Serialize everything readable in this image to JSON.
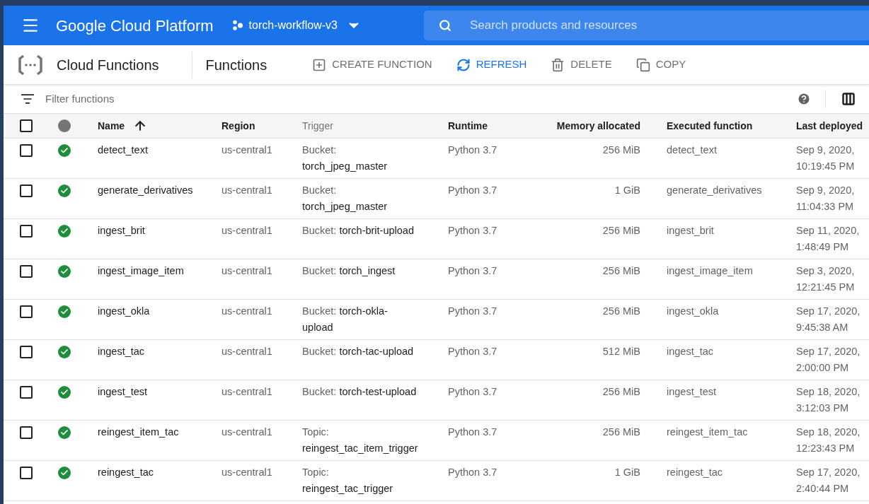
{
  "header": {
    "product": "Google Cloud Platform",
    "project": "torch-workflow-v3",
    "search": {
      "placeholder": "Search products and resources"
    }
  },
  "toolbar": {
    "service": "Cloud Functions",
    "page": "Functions",
    "actions": [
      {
        "kind": "create",
        "label": "CREATE FUNCTION",
        "disabled": true
      },
      {
        "kind": "refresh",
        "label": "REFRESH",
        "disabled": false
      },
      {
        "kind": "delete",
        "label": "DELETE",
        "disabled": true
      },
      {
        "kind": "copy",
        "label": "COPY",
        "disabled": true
      }
    ]
  },
  "filter": {
    "placeholder": "Filter functions"
  },
  "table": {
    "select_all": {
      "checked": false
    },
    "columns": [
      {
        "label": "Name",
        "sortable": true,
        "sorted": true
      },
      {
        "label": "Region",
        "sortable": true,
        "sorted": false
      },
      {
        "label": "Trigger",
        "sortable": false,
        "sorted": false
      },
      {
        "label": "Runtime",
        "sortable": true,
        "sorted": false
      },
      {
        "label": "Memory allocated",
        "sortable": true,
        "sorted": false
      },
      {
        "label": "Executed function",
        "sortable": true,
        "sorted": false
      },
      {
        "label": "Last deployed",
        "sortable": true,
        "sorted": false
      }
    ],
    "rows": [
      {
        "checked": false,
        "healthy": true,
        "name": "detect_text",
        "region": "us-central1",
        "trigger_type": "Bucket:",
        "trigger": "torch_jpeg_master",
        "runtime": "Python 3.7",
        "memory": "256 MiB",
        "executed": "detect_text",
        "deployed": "Sep 9, 2020, 10:19:45 PM"
      },
      {
        "checked": false,
        "healthy": true,
        "name": "generate_derivatives",
        "region": "us-central1",
        "trigger_type": "Bucket:",
        "trigger": "torch_jpeg_master",
        "runtime": "Python 3.7",
        "memory": "1 GiB",
        "executed": "generate_derivatives",
        "deployed": "Sep 9, 2020, 11:04:33 PM"
      },
      {
        "checked": false,
        "healthy": true,
        "name": "ingest_brit",
        "region": "us-central1",
        "trigger_type": "Bucket:",
        "trigger": "torch-brit-upload",
        "runtime": "Python 3.7",
        "memory": "256 MiB",
        "executed": "ingest_brit",
        "deployed": "Sep 11, 2020, 1:48:49 PM"
      },
      {
        "checked": false,
        "healthy": true,
        "name": "ingest_image_item",
        "region": "us-central1",
        "trigger_type": "Bucket:",
        "trigger": "torch_ingest",
        "runtime": "Python 3.7",
        "memory": "256 MiB",
        "executed": "ingest_image_item",
        "deployed": "Sep 3, 2020, 12:21:45 PM"
      },
      {
        "checked": false,
        "healthy": true,
        "name": "ingest_okla",
        "region": "us-central1",
        "trigger_type": "Bucket:",
        "trigger": "torch-okla-upload",
        "runtime": "Python 3.7",
        "memory": "256 MiB",
        "executed": "ingest_okla",
        "deployed": "Sep 17, 2020, 9:45:38 AM"
      },
      {
        "checked": false,
        "healthy": true,
        "name": "ingest_tac",
        "region": "us-central1",
        "trigger_type": "Bucket:",
        "trigger": "torch-tac-upload",
        "runtime": "Python 3.7",
        "memory": "512 MiB",
        "executed": "ingest_tac",
        "deployed": "Sep 17, 2020, 2:00:00 PM"
      },
      {
        "checked": false,
        "healthy": true,
        "name": "ingest_test",
        "region": "us-central1",
        "trigger_type": "Bucket:",
        "trigger": "torch-test-upload",
        "runtime": "Python 3.7",
        "memory": "256 MiB",
        "executed": "ingest_test",
        "deployed": "Sep 18, 2020, 3:12:03 PM"
      },
      {
        "checked": false,
        "healthy": true,
        "name": "reingest_item_tac",
        "region": "us-central1",
        "trigger_type": "Topic:",
        "trigger": "reingest_tac_item_trigger",
        "runtime": "Python 3.7",
        "memory": "256 MiB",
        "executed": "reingest_item_tac",
        "deployed": "Sep 18, 2020, 12:23:43 PM"
      },
      {
        "checked": false,
        "healthy": true,
        "name": "reingest_tac",
        "region": "us-central1",
        "trigger_type": "Topic:",
        "trigger": "reingest_tac_trigger",
        "runtime": "Python 3.7",
        "memory": "1 GiB",
        "executed": "reingest_tac",
        "deployed": "Sep 17, 2020, 2:40:44 PM"
      }
    ]
  }
}
